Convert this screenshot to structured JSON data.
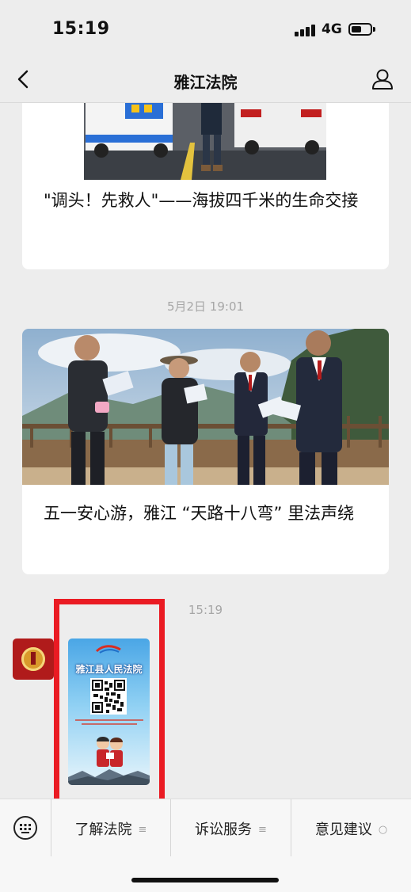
{
  "status_bar": {
    "time": "15:19",
    "network": "4G"
  },
  "nav": {
    "title": "雅江法院"
  },
  "feed": {
    "articles": [
      {
        "title": "\"调头！先救人\"——海拔四千米的生命交接"
      },
      {
        "timestamp": "5月2日 19:01",
        "title": "五一安心游，雅江 “天路十八弯” 里法声绕"
      }
    ],
    "message": {
      "timestamp": "15:19",
      "poster_headline": "雅江县人民法院"
    }
  },
  "bottom_menu": {
    "items": [
      {
        "label": "了解法院",
        "glyph": "≡"
      },
      {
        "label": "诉讼服务",
        "glyph": "≡"
      },
      {
        "label": "意见建议",
        "glyph": "○"
      }
    ]
  },
  "icons": {
    "back": "chevron-left-icon",
    "profile": "person-icon",
    "keyboard": "keyboard-icon",
    "court_emblem": "court-emblem-icon"
  },
  "colors": {
    "highlight_border": "#ea1b23",
    "avatar_background": "#b01b1b"
  }
}
